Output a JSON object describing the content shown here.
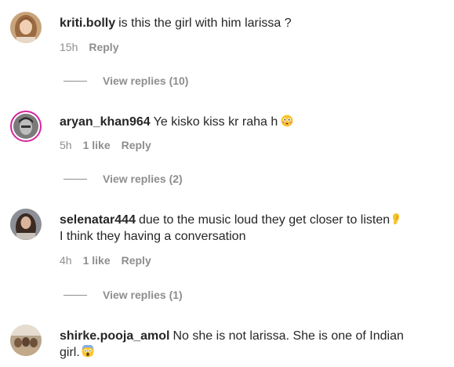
{
  "comments": [
    {
      "username": "kriti.bolly",
      "text": "is this the girl with him larissa ?",
      "time": "15h",
      "likes": "",
      "reply_label": "Reply",
      "view_replies": "View replies (10)"
    },
    {
      "username": "aryan_khan964",
      "text": "Ye kisko kiss kr raha h",
      "emoji": "flushed-face",
      "time": "5h",
      "likes": "1 like",
      "reply_label": "Reply",
      "view_replies": "View replies (2)"
    },
    {
      "username": "selenatar444",
      "text": "due to the music loud they get closer to listen",
      "emoji": "ear",
      "text_line2": "I think they having a conversation",
      "time": "4h",
      "likes": "1 like",
      "reply_label": "Reply",
      "view_replies": "View replies (1)"
    },
    {
      "username": "shirke.pooja_amol",
      "text": "No she is not larissa. She is one of Indian",
      "text_line2": "girl.",
      "emoji": "face-screaming"
    }
  ],
  "colors": {
    "text": "#262626",
    "secondary": "#8e8e8e",
    "story_ring": "#d6249f"
  }
}
